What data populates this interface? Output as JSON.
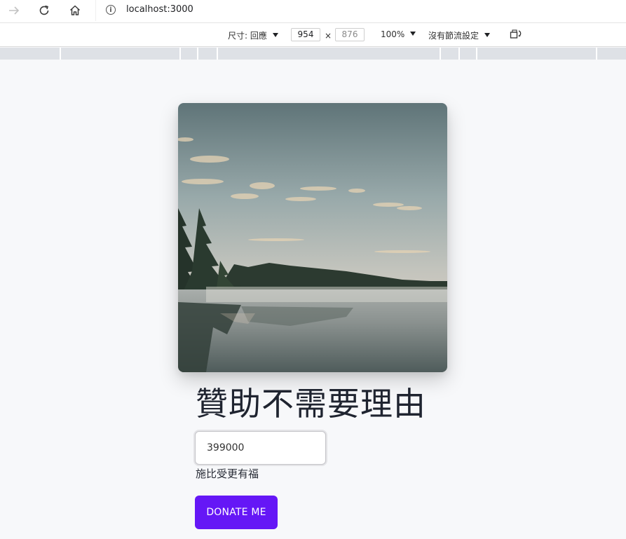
{
  "browser": {
    "url": "localhost:3000",
    "back_icon": "arrow-right-icon",
    "reload_icon": "reload-icon",
    "home_icon": "home-icon",
    "info_icon": "info-icon"
  },
  "device_toolbar": {
    "dimension_label": "尺寸: 回應",
    "width_value": "954",
    "height_value": "876",
    "zoom": "100%",
    "throttling": "沒有節流設定",
    "rotate_icon": "rotate-icon"
  },
  "page": {
    "photo_alt": "Misty lake with pine forest at dawn",
    "headline": "贊助不需要理由",
    "amount_value": "399000",
    "helper_text": "施比受更有福",
    "donate_label": "DONATE ME",
    "accent_color": "#6517f6"
  }
}
